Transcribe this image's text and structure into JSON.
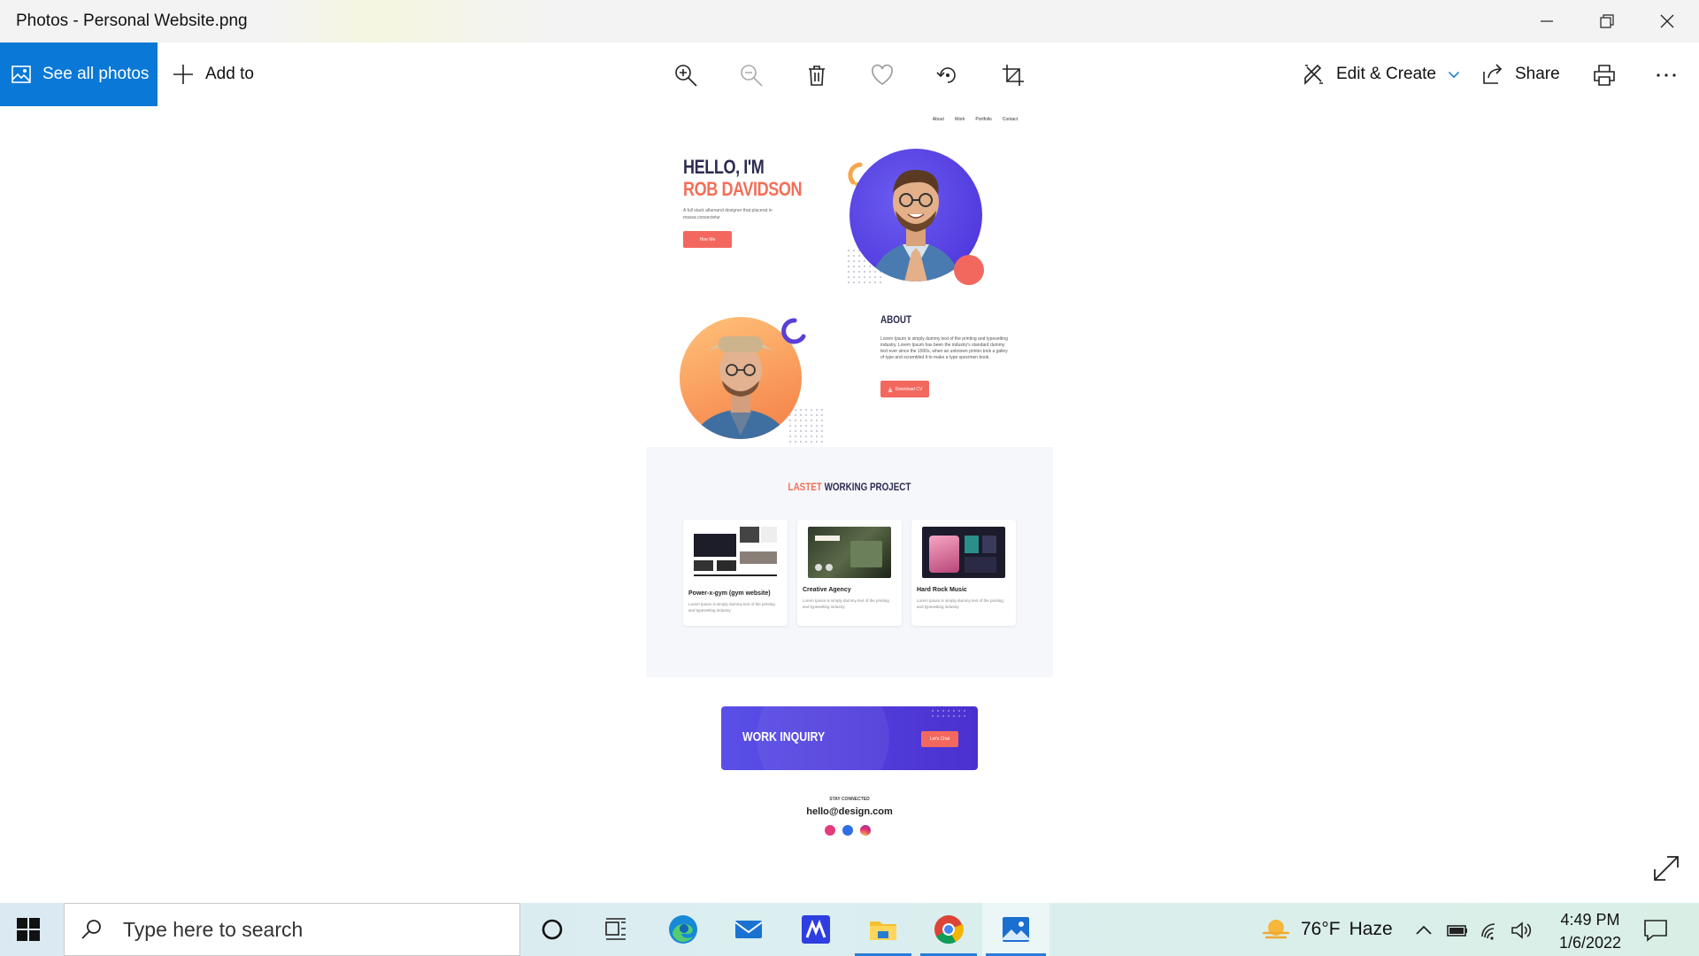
{
  "window": {
    "title": "Photos - Personal Website.png",
    "controls": [
      "minimize-icon",
      "restore-icon",
      "close-icon"
    ]
  },
  "toolbar": {
    "see_all_label": "See all photos",
    "add_to_label": "Add to",
    "icons": [
      "zoom-in-icon",
      "zoom-out-icon",
      "delete-icon",
      "favorite-icon",
      "rotate-icon",
      "crop-icon"
    ],
    "edit_create_label": "Edit & Create",
    "share_label": "Share",
    "print_icon": "print-icon",
    "more_icon": "more-icon",
    "accent": "#0a78d7"
  },
  "photo": {
    "nav": [
      "About",
      "Work",
      "Portfolio",
      "Contact"
    ],
    "hero": {
      "line1": "HELLO, I'M",
      "line2": "ROB DAVIDSON",
      "subtitle": "A full stack allaround designer that placerat in massa consectetur",
      "button": "Hire Me"
    },
    "about": {
      "title": "ABOUT",
      "text": "Lorem Ipsum is simply dummy text of the printing and typesetting industry. Lorem Ipsum has been the industry's standard dummy text ever since the 1500s, when an unknown printer took a galley of type and scrambled it to make a type specimen book.",
      "button": "Download CV"
    },
    "projects": {
      "title_accent": "LASTET",
      "title_rest": "WORKING PROJECT",
      "cards": [
        {
          "name": "Power-x-gym (gym website)",
          "desc": "Lorem Ipsum is simply dummy text of the printing and typesetting industry."
        },
        {
          "name": "Creative Agency",
          "desc": "Lorem Ipsum is simply dummy text of the printing and typesetting industry."
        },
        {
          "name": "Hard Rock Music",
          "desc": "Lorem Ipsum is simply dummy text of the printing and typesetting industry."
        }
      ]
    },
    "inquiry": {
      "title": "WORK INQUIRY",
      "button": "Let's Chat"
    },
    "footer": {
      "stay": "STAY CONNECTED",
      "email": "hello@design.com",
      "socials": [
        "dribbble-icon",
        "behance-icon",
        "instagram-icon"
      ]
    },
    "colors": {
      "navy": "#2b2b52",
      "coral": "#f26f59",
      "purple": "#5a4fe8",
      "orange": "#f6a64a"
    }
  },
  "taskbar": {
    "search_placeholder": "Type here to search",
    "apps": [
      "cortana-icon",
      "task-view-icon",
      "edge-icon",
      "mail-icon",
      "app-icon",
      "file-explorer-icon",
      "chrome-icon",
      "photos-icon"
    ],
    "weather_temp": "76°F",
    "weather_desc": "Haze",
    "time": "4:49 PM",
    "date": "1/6/2022"
  }
}
